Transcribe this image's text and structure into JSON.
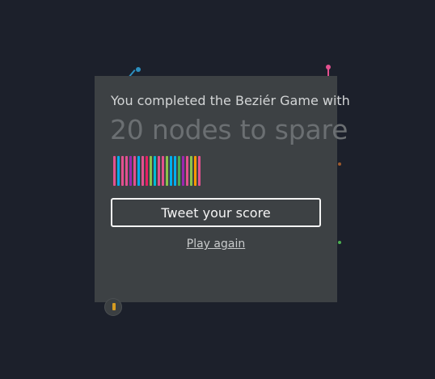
{
  "game": {
    "title_line": "You completed the Beziér Game with",
    "result_line": "20 nodes to spare",
    "tweet_label": "Tweet your score",
    "play_again_label": "Play again",
    "colors": {
      "background": "#1c202b",
      "modal": "#3d4144",
      "stripes": [
        "#e4508f",
        "#00aeef",
        "#e4508f",
        "#e4508f",
        "#9c27b0",
        "#e4508f",
        "#00aeef",
        "#e4508f",
        "#e91e63",
        "#8bc34a",
        "#00bcd4",
        "#e4508f",
        "#e4508f",
        "#8bc34a",
        "#00aeef",
        "#00aeef",
        "#4caf50",
        "#9c27b0",
        "#e4508f",
        "#8bc34a",
        "#ff9800",
        "#e4508f"
      ]
    }
  },
  "decor": {
    "handle_colors": [
      "#2c8fbf",
      "#e4508f",
      "#9e5a2d",
      "#4caf50"
    ]
  }
}
